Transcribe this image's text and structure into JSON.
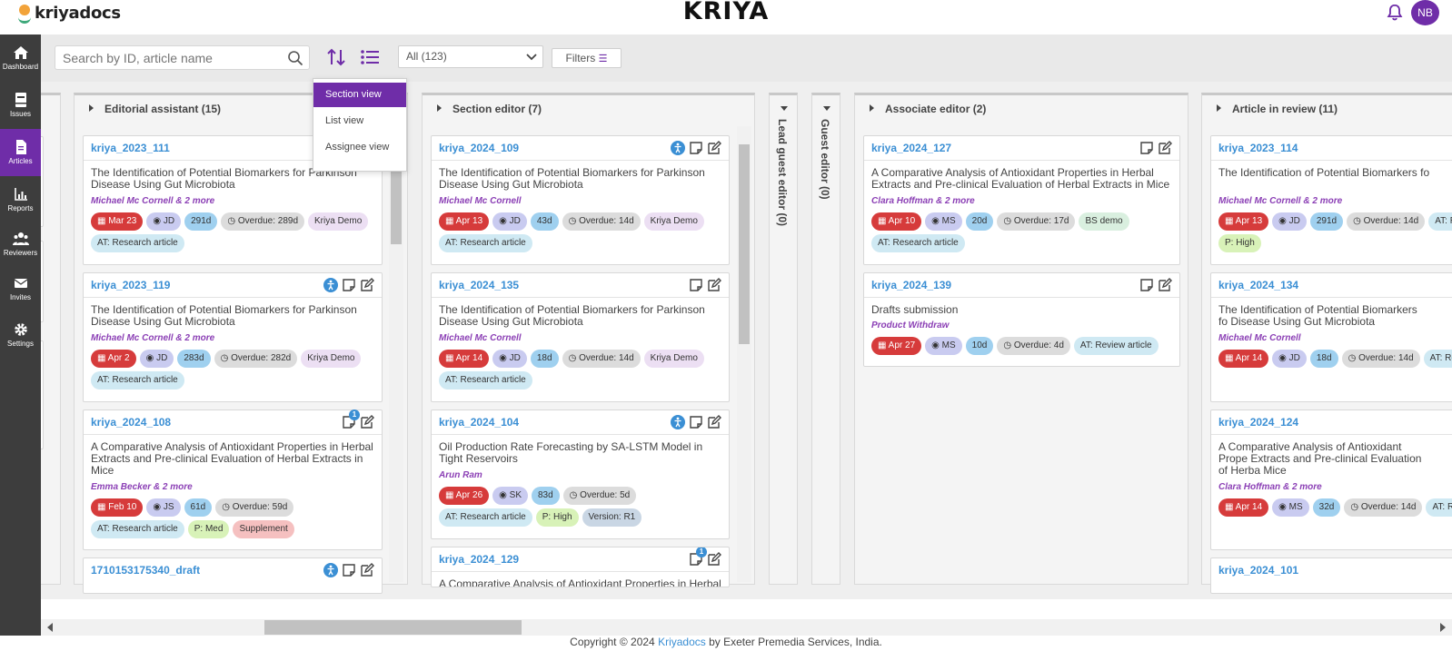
{
  "header": {
    "logo_text": "kriyadocs",
    "brand": "KRIYA",
    "avatar_initials": "NB"
  },
  "sidebar": {
    "items": [
      {
        "label": "Dashboard",
        "icon": "home-icon"
      },
      {
        "label": "Issues",
        "icon": "book-icon"
      },
      {
        "label": "Articles",
        "icon": "document-icon"
      },
      {
        "label": "Reports",
        "icon": "chart-icon"
      },
      {
        "label": "Reviewers",
        "icon": "users-icon"
      },
      {
        "label": "Invites",
        "icon": "mail-icon"
      },
      {
        "label": "Settings",
        "icon": "gear-icon"
      }
    ]
  },
  "toolbar": {
    "search_placeholder": "Search by ID, article name",
    "select_value": "All  (123)",
    "filters_label": "Filters"
  },
  "view_menu": {
    "options": [
      "Section view",
      "List view",
      "Assignee view"
    ],
    "selected": "Section view"
  },
  "columns": [
    {
      "title": "Editorial assistant (15)",
      "cards": [
        {
          "id": "kriya_2023_111",
          "title": "The Identification of Potential Biomarkers for Parkinson Disease Using Gut Microbiota",
          "authors": "Michael Mc Cornell & 2 more",
          "chips": [
            "Mar 23",
            "JD",
            "291d",
            "Overdue: 289d",
            "Kriya Demo",
            "AT: Research article"
          ]
        },
        {
          "id": "kriya_2023_119",
          "title": "The Identification of Potential Biomarkers for Parkinson Disease Using Gut Microbiota",
          "authors": "Michael Mc Cornell & 2 more",
          "chips": [
            "Apr 2",
            "JD",
            "283d",
            "Overdue: 282d",
            "Kriya Demo",
            "AT: Research article"
          ]
        },
        {
          "id": "kriya_2024_108",
          "title": "A Comparative Analysis of Antioxidant Properties in Herbal Extracts and Pre-clinical Evaluation of Herbal Extracts in Mice",
          "authors": "Emma Becker & 2 more",
          "chips": [
            "Feb 10",
            "JS",
            "61d",
            "Overdue: 59d",
            "AT: Research article",
            "P: Med",
            "Supplement"
          ],
          "badge": "1"
        },
        {
          "id": "1710153175340_draft"
        }
      ]
    },
    {
      "title": "Section editor (7)",
      "cards": [
        {
          "id": "kriya_2024_109",
          "title": "The Identification of Potential Biomarkers for Parkinson Disease Using Gut Microbiota",
          "authors": "Michael Mc Cornell",
          "chips": [
            "Apr 13",
            "JD",
            "43d",
            "Overdue: 14d",
            "Kriya Demo",
            "AT: Research article"
          ]
        },
        {
          "id": "kriya_2024_135",
          "title": "The Identification of Potential Biomarkers for Parkinson Disease Using Gut Microbiota",
          "authors": "Michael Mc Cornell",
          "chips": [
            "Apr 14",
            "JD",
            "18d",
            "Overdue: 14d",
            "Kriya Demo",
            "AT: Research article"
          ]
        },
        {
          "id": "kriya_2024_104",
          "title": "Oil Production Rate Forecasting by SA-LSTM Model in Tight Reservoirs",
          "authors": "Arun Ram",
          "chips": [
            "Apr 26",
            "SK",
            "83d",
            "Overdue: 5d",
            "AT: Research article",
            "P: High",
            "Version: R1"
          ]
        },
        {
          "id": "kriya_2024_129",
          "title": "A Comparative Analysis of Antioxidant Properties in Herbal",
          "badge": "1"
        }
      ]
    },
    {
      "title": "Lead guest editor (0)"
    },
    {
      "title": "Guest editor (0)"
    },
    {
      "title": "Associate editor (2)",
      "cards": [
        {
          "id": "kriya_2024_127",
          "title": "A Comparative Analysis of Antioxidant Properties in Herbal Extracts and Pre-clinical Evaluation of Herbal Extracts in Mice",
          "authors": "Clara Hoffman & 2 more",
          "chips": [
            "Apr 10",
            "MS",
            "20d",
            "Overdue: 17d",
            "BS demo",
            "AT: Research article"
          ]
        },
        {
          "id": "kriya_2024_139",
          "title": "Drafts submission",
          "authors": "Product Withdraw",
          "chips": [
            "Apr 27",
            "MS",
            "10d",
            "Overdue: 4d",
            "AT: Review article"
          ]
        }
      ]
    },
    {
      "title": "Article in review (11)",
      "cards": [
        {
          "id": "kriya_2023_114",
          "title": "The Identification of Potential Biomarkers fo",
          "authors": "Michael Mc Cornell & 2 more",
          "chips": [
            "Apr 13",
            "JD",
            "291d",
            "Overdue: 14d",
            "AT: Research article",
            "P: High"
          ]
        },
        {
          "id": "kriya_2024_134",
          "title": "The Identification of Potential Biomarkers fo Disease Using Gut Microbiota",
          "authors": "Michael Mc Cornell",
          "chips": [
            "Apr 14",
            "JD",
            "18d",
            "Overdue: 14d",
            "AT: Research article"
          ]
        },
        {
          "id": "kriya_2024_124",
          "title": "A Comparative Analysis of Antioxidant Prope Extracts and Pre-clinical Evaluation of Herba Mice",
          "authors": "Clara Hoffman & 2 more",
          "chips": [
            "Apr 14",
            "MS",
            "32d",
            "Overdue: 14d",
            "AT: Research article"
          ]
        },
        {
          "id": "kriya_2024_101"
        }
      ]
    }
  ],
  "footer": {
    "prefix": "Copyright © 2024 ",
    "link": "Kriyadocs",
    "suffix": " by Exeter Premedia Services, India."
  },
  "colors": {
    "accent": "#6f2da8",
    "link": "#3b8fd4",
    "date_chip": "#d63b3b"
  }
}
